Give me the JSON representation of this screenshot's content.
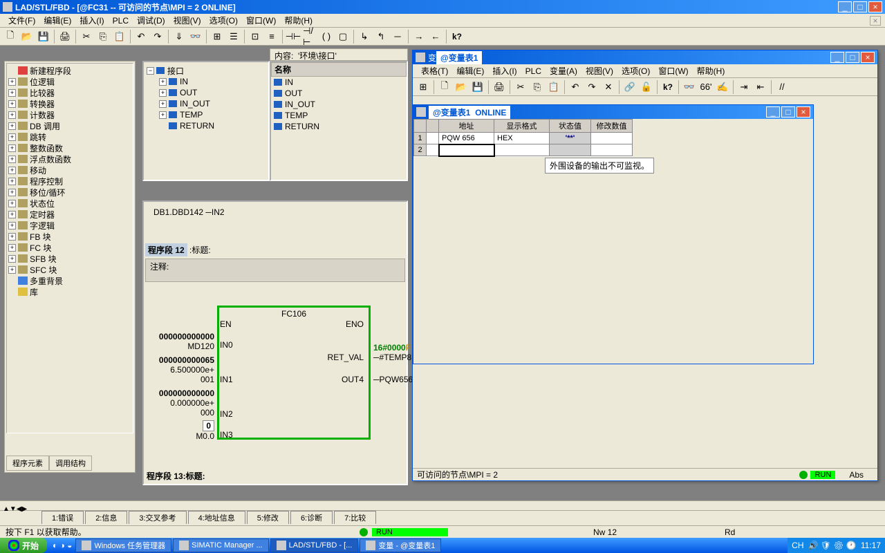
{
  "title": "LAD/STL/FBD   - [@FC31 -- 可访问的节点\\MPI =    2  ONLINE]",
  "menu": [
    "文件(F)",
    "编辑(E)",
    "插入(I)",
    "PLC",
    "调试(D)",
    "视图(V)",
    "选项(O)",
    "窗口(W)",
    "帮助(H)"
  ],
  "tree": [
    {
      "label": "新建程序段",
      "icon": "new"
    },
    {
      "label": "位逻辑"
    },
    {
      "label": "比较器"
    },
    {
      "label": "转换器"
    },
    {
      "label": "计数器"
    },
    {
      "label": "DB 调用"
    },
    {
      "label": "跳转"
    },
    {
      "label": "整数函数"
    },
    {
      "label": "浮点数函数"
    },
    {
      "label": "移动"
    },
    {
      "label": "程序控制"
    },
    {
      "label": "移位/循环"
    },
    {
      "label": "状态位"
    },
    {
      "label": "定时器"
    },
    {
      "label": "字逻辑"
    },
    {
      "label": "FB 块"
    },
    {
      "label": "FC 块"
    },
    {
      "label": "SFB 块"
    },
    {
      "label": "SFC 块"
    },
    {
      "label": "多重背景",
      "icon": "multi"
    },
    {
      "label": "库",
      "icon": "lib"
    }
  ],
  "left_tabs": [
    "程序元素",
    "调用结构"
  ],
  "content_label": "内容:",
  "content_path": "'环境\\接口'",
  "intf_tree": [
    "接口",
    "IN",
    "OUT",
    "IN_OUT",
    "TEMP",
    "RETURN"
  ],
  "name_hdr": "名称",
  "name_list": [
    "IN",
    "OUT",
    "IN_OUT",
    "TEMP",
    "RETURN"
  ],
  "ladder": {
    "db_line": "DB1.DBD142",
    "in_lbl": "IN2",
    "seg_title": "程序段 12",
    "title_lbl": ":标题:",
    "comment_lbl": "注释:",
    "fc_name": "FC106",
    "ports_left": [
      "EN",
      "IN0",
      "IN1",
      "IN2",
      "IN3"
    ],
    "ports_right": [
      "ENO",
      "RET_VAL",
      "OUT4"
    ],
    "vals_left": [
      "000000000000",
      "MD120",
      "000000000065",
      "6.500000e+",
      "001",
      "000000000000",
      "0.000000e+",
      "000",
      "0",
      "M0.0"
    ],
    "ret_hex": "16#0000",
    "ret_var": "#TEMP8",
    "ret_suffix": "P8",
    "out4_target": "PQW656",
    "seg13": "程序段  13:标题:"
  },
  "var_win": {
    "outer_title": "变量 - @变量表1",
    "menu": [
      "表格(T)",
      "编辑(E)",
      "插入(I)",
      "PLC",
      "变量(A)",
      "视图(V)",
      "选项(O)",
      "窗口(W)",
      "帮助(H)"
    ],
    "inner_title_a": "@变量表1",
    "inner_title_b": "ONLINE",
    "cols": [
      "",
      "",
      "地址",
      "显示格式",
      "状态值",
      "修改数值"
    ],
    "rows": [
      {
        "n": "1",
        "addr": "PQW  656",
        "fmt": "HEX",
        "status": "'**'"
      },
      {
        "n": "2",
        "addr": "",
        "fmt": "",
        "status": ""
      }
    ],
    "warning": "外围设备的输出不可监视。",
    "status_left": "可访问的节点\\MPI =    2",
    "run_label": "RUN",
    "abs_label": "Abs"
  },
  "out_tabs": [
    "1:错误",
    "2:信息",
    "3:交叉参考",
    "4:地址信息",
    "5:修改",
    "6:诊断",
    "7:比较"
  ],
  "status": {
    "help": "按下 F1 以获取帮助。",
    "run": "RUN",
    "nw": "Nw 12",
    "rd": "Rd"
  },
  "taskbar": {
    "start": "开始",
    "items": [
      "Windows 任务管理器",
      "SIMATIC Manager ...",
      "LAD/STL/FBD  - [...",
      "变量 - @变量表1"
    ],
    "tray_lang": "CH",
    "time": "11:17"
  }
}
